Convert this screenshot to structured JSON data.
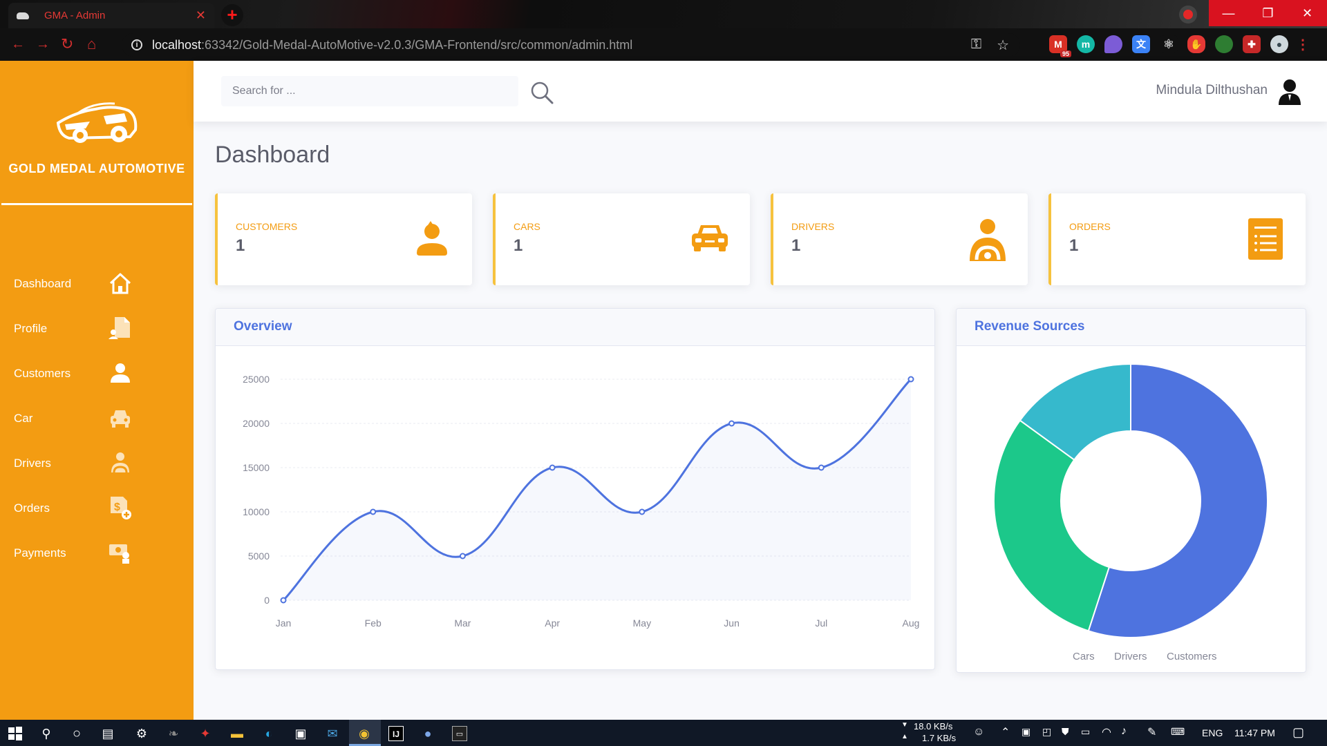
{
  "browser": {
    "tab_title": "GMA - Admin",
    "tab_close": "✕",
    "new_tab": "+",
    "url_host": "localhost",
    "url_rest": ":63342/Gold-Medal-AutoMotive-v2.0.3/GMA-Frontend/src/common/admin.html",
    "ext_badge": "95",
    "window_controls": [
      "—",
      "❐",
      "✕"
    ]
  },
  "sidebar": {
    "brand": "GOLD MEDAL AUTOMOTIVE",
    "items": [
      {
        "label": "Dashboard",
        "icon": "home-icon"
      },
      {
        "label": "Profile",
        "icon": "profile-icon"
      },
      {
        "label": "Customers",
        "icon": "customer-icon"
      },
      {
        "label": "Car",
        "icon": "car-icon"
      },
      {
        "label": "Drivers",
        "icon": "driver-icon"
      },
      {
        "label": "Orders",
        "icon": "order-icon"
      },
      {
        "label": "Payments",
        "icon": "payment-icon"
      }
    ]
  },
  "topbar": {
    "search_placeholder": "Search for ...",
    "user_name": "Mindula Dilthushan"
  },
  "page": {
    "title": "Dashboard"
  },
  "cards": [
    {
      "label": "Customers",
      "value": "1",
      "icon": "user-icon"
    },
    {
      "label": "Cars",
      "value": "1",
      "icon": "car-icon"
    },
    {
      "label": "Drivers",
      "value": "1",
      "icon": "driver-icon"
    },
    {
      "label": "Orders",
      "value": "1",
      "icon": "list-icon"
    }
  ],
  "overview": {
    "title": "Overview",
    "chart_data": {
      "type": "line",
      "categories": [
        "Jan",
        "Feb",
        "Mar",
        "Apr",
        "May",
        "Jun",
        "Jul",
        "Aug"
      ],
      "values": [
        0,
        10000,
        5000,
        15000,
        10000,
        20000,
        15000,
        25000
      ],
      "yticks": [
        "25000",
        "20000",
        "15000",
        "10000",
        "5000",
        "0"
      ],
      "ylim": [
        0,
        25000
      ],
      "color": "#4e73df",
      "grid": true
    }
  },
  "revenue": {
    "title": "Revenue Sources",
    "chart_data": {
      "type": "pie",
      "categories": [
        "Cars",
        "Drivers",
        "Customers"
      ],
      "values": [
        55,
        30,
        15
      ],
      "colors": [
        "#4e73df",
        "#1cc88a",
        "#36b9cc"
      ],
      "legend": "bottom"
    }
  },
  "taskbar": {
    "net_down": "18.0 KB/s",
    "net_up": "1.7 KB/s",
    "lang": "ENG",
    "time": "11:47 PM"
  }
}
